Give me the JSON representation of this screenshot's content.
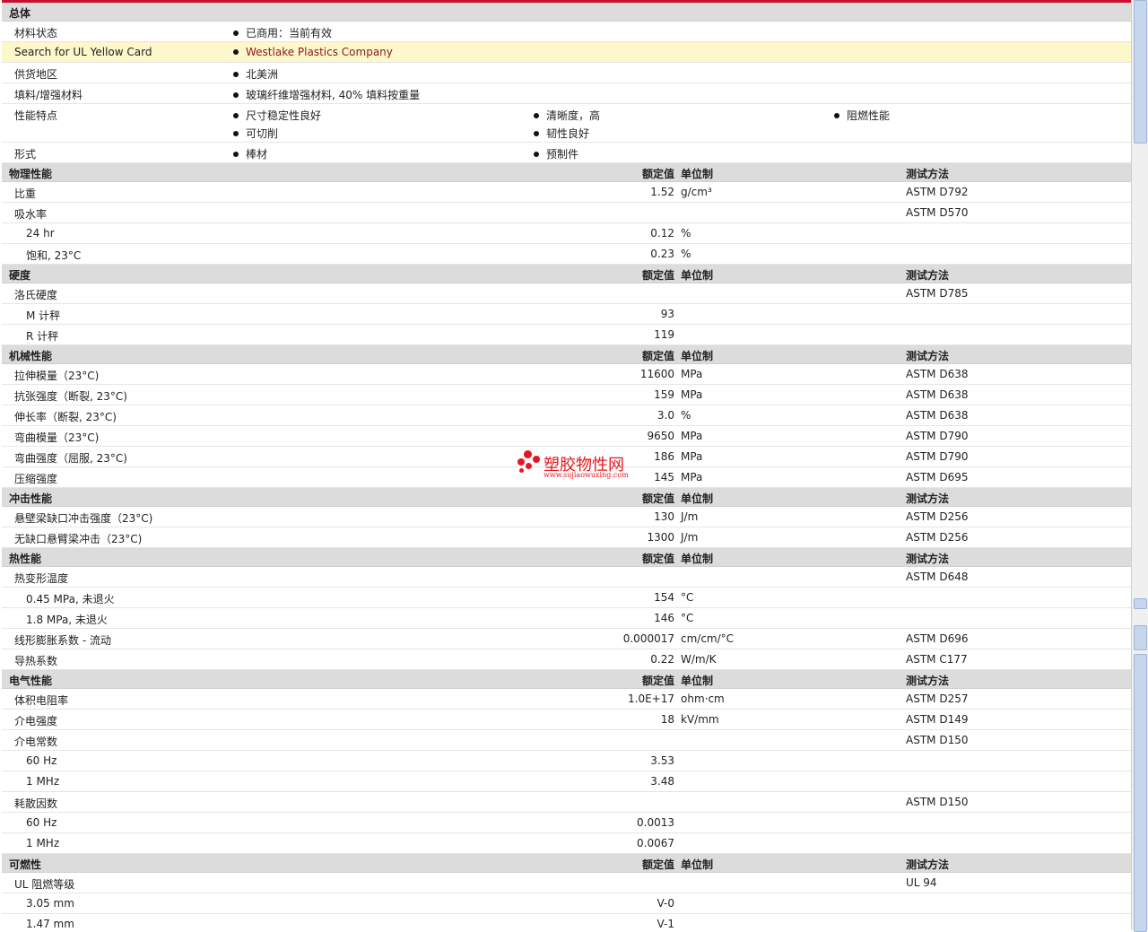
{
  "general": {
    "title": "总体",
    "rows": [
      {
        "label": "材料状态",
        "cols": [
          [
            "已商用：当前有效"
          ]
        ]
      },
      {
        "label": "Search for UL Yellow Card",
        "cols": [
          [
            "Westlake Plastics Company"
          ]
        ],
        "highlight": true
      },
      {
        "label": "供货地区",
        "cols": [
          [
            "北美洲"
          ]
        ]
      },
      {
        "label": "填料/增强材料",
        "cols": [
          [
            "玻璃纤维增强材料, 40% 填料按重量"
          ]
        ]
      },
      {
        "label": "性能特点",
        "cols": [
          [
            "尺寸稳定性良好",
            "可切削"
          ],
          [
            "清晰度，高",
            "韧性良好"
          ],
          [
            "阻燃性能"
          ]
        ]
      },
      {
        "label": "形式",
        "cols": [
          [
            "棒材"
          ],
          [
            "预制件"
          ]
        ]
      }
    ]
  },
  "headers": {
    "value": "额定值",
    "unit": "单位制",
    "method": "测试方法"
  },
  "sections": [
    {
      "title": "物理性能",
      "rows": [
        {
          "label": "比重",
          "value": "1.52",
          "unit": "g/cm³",
          "method": "ASTM D792"
        },
        {
          "label": "吸水率",
          "value": "",
          "unit": "",
          "method": "ASTM D570"
        },
        {
          "label": "24 hr",
          "sub": true,
          "value": "0.12",
          "unit": "%",
          "method": ""
        },
        {
          "label": "饱和, 23°C",
          "sub": true,
          "value": "0.23",
          "unit": "%",
          "method": ""
        }
      ]
    },
    {
      "title": "硬度",
      "rows": [
        {
          "label": "洛氏硬度",
          "value": "",
          "unit": "",
          "method": "ASTM D785"
        },
        {
          "label": "M 计秤",
          "sub": true,
          "value": "93",
          "unit": "",
          "method": ""
        },
        {
          "label": "R 计秤",
          "sub": true,
          "value": "119",
          "unit": "",
          "method": ""
        }
      ]
    },
    {
      "title": "机械性能",
      "rows": [
        {
          "label": "拉伸模量（23°C)",
          "value": "11600",
          "unit": "MPa",
          "method": "ASTM D638"
        },
        {
          "label": "抗张强度（断裂, 23°C)",
          "value": "159",
          "unit": "MPa",
          "method": "ASTM D638"
        },
        {
          "label": "伸长率（断裂, 23°C)",
          "value": "3.0",
          "unit": "%",
          "method": "ASTM D638"
        },
        {
          "label": "弯曲模量（23°C)",
          "value": "9650",
          "unit": "MPa",
          "method": "ASTM D790"
        },
        {
          "label": "弯曲强度（屈服, 23°C)",
          "value": "186",
          "unit": "MPa",
          "method": "ASTM D790"
        },
        {
          "label": "压缩强度",
          "value": "145",
          "unit": "MPa",
          "method": "ASTM D695"
        }
      ]
    },
    {
      "title": "冲击性能",
      "rows": [
        {
          "label": "悬壁梁缺口冲击强度（23°C)",
          "value": "130",
          "unit": "J/m",
          "method": "ASTM D256"
        },
        {
          "label": "无缺口悬臂梁冲击（23°C)",
          "value": "1300",
          "unit": "J/m",
          "method": "ASTM D256"
        }
      ]
    },
    {
      "title": "热性能",
      "rows": [
        {
          "label": "热变形温度",
          "value": "",
          "unit": "",
          "method": "ASTM D648"
        },
        {
          "label": "0.45 MPa, 未退火",
          "sub": true,
          "value": "154",
          "unit": "°C",
          "method": ""
        },
        {
          "label": "1.8 MPa, 未退火",
          "sub": true,
          "value": "146",
          "unit": "°C",
          "method": ""
        },
        {
          "label": "线形膨胀系数 - 流动",
          "value": "0.000017",
          "unit": "cm/cm/°C",
          "method": "ASTM D696"
        },
        {
          "label": "导热系数",
          "value": "0.22",
          "unit": "W/m/K",
          "method": "ASTM C177"
        }
      ]
    },
    {
      "title": "电气性能",
      "rows": [
        {
          "label": "体积电阻率",
          "value": "1.0E+17",
          "unit": "ohm·cm",
          "method": "ASTM D257"
        },
        {
          "label": "介电强度",
          "value": "18",
          "unit": "kV/mm",
          "method": "ASTM D149"
        },
        {
          "label": "介电常数",
          "value": "",
          "unit": "",
          "method": "ASTM D150"
        },
        {
          "label": "60 Hz",
          "sub": true,
          "value": "3.53",
          "unit": "",
          "method": ""
        },
        {
          "label": "1 MHz",
          "sub": true,
          "value": "3.48",
          "unit": "",
          "method": ""
        },
        {
          "label": "耗散因数",
          "value": "",
          "unit": "",
          "method": "ASTM D150"
        },
        {
          "label": "60 Hz",
          "sub": true,
          "value": "0.0013",
          "unit": "",
          "method": ""
        },
        {
          "label": "1 MHz",
          "sub": true,
          "value": "0.0067",
          "unit": "",
          "method": ""
        }
      ]
    },
    {
      "title": "可燃性",
      "rows": [
        {
          "label": "UL 阻燃等级",
          "value": "",
          "unit": "",
          "method": "UL 94"
        },
        {
          "label": "3.05 mm",
          "sub": true,
          "value": "V-0",
          "unit": "",
          "method": ""
        },
        {
          "label": "1.47 mm",
          "sub": true,
          "value": "V-1",
          "unit": "",
          "method": ""
        }
      ]
    }
  ],
  "watermark": {
    "name": "塑胶物性网",
    "url": "www.sujiaowuxing.com"
  },
  "colors": {
    "accent": "#c8102e",
    "section_bg": "#dcdcdc",
    "highlight_bg": "#fdf7cc",
    "link": "#8b1a1a",
    "watermark": "#e8161f"
  }
}
